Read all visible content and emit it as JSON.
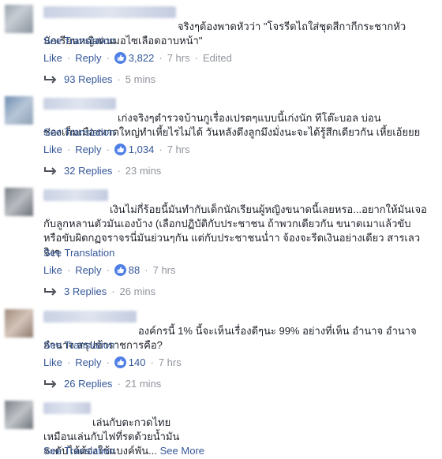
{
  "comments": [
    {
      "text": "จริงๆต้องพาดหัวว่า \"โจรรีดไถใส่ชุดสีกากีกระชากหัว\nนักเรียนหญิงคนมอไซเลือดอาบหน้า\"",
      "see_translation": "See Translation",
      "like": "Like",
      "reply": "Reply",
      "reaction_count": "3,822",
      "time": "7 hrs",
      "edited": "Edited",
      "replies_label": "93 Replies",
      "replies_time": "5 mins"
    },
    {
      "text": "เก่งจริงๆตำรวจบ้านกูเรื่องเปรตๆแบบนี้เก่งนัก ทีโต๊ะบอล บ่อน\nซ่องเต็มเมืองหาดใหญ่ทำเหี้ยไรไม่ได้ วันหลังดึงลูกมึงมั่งนะจะได้รู้สึกเดียวกัน เหี้ยเอ้ยยย",
      "see_translation": "See Translation",
      "like": "Like",
      "reply": "Reply",
      "reaction_count": "1,034",
      "time": "7 hrs",
      "replies_label": "32 Replies",
      "replies_time": "23 mins"
    },
    {
      "text": "เงินไม่กี่ร้อยนี้มันทำกับเด็กนักเรียนผู้หญิงขนาดนี้เลยหรอ...อยากให้มันเจอ\nกับลูกหลานตัวมันเองบ้าง (เลือกปฏิบัติกับประชาชน ถ้าพวกเดียวกัน ขนาดเมาแล้วขับ\nหรือขับผิดกฏจราจรนี่มันย่วนๆกัน แต่กับประชาชนน่ำา จ้องจะรีดเงินอย่างเดียว สารเลว\nจิงๆ",
      "see_translation": "See Translation",
      "like": "Like",
      "reply": "Reply",
      "reaction_count": "88",
      "time": "7 hrs",
      "replies_label": "3 Replies",
      "replies_time": "26 mins"
    },
    {
      "text": "องค์กรนี้ 1% นี้จะเห็นเรื่องดีๆนะ 99% อย่างที่เห็น อำนาจ อำนาจ\nอำนาจ สรุปข้าราชการคือ?",
      "see_translation": "See Translation",
      "like": "Like",
      "reply": "Reply",
      "reaction_count": "140",
      "time": "7 hrs",
      "replies_label": "26 Replies",
      "replies_time": "21 mins"
    },
    {
      "text": "เล่นกับตะกวดไทย\nเหมือนเล่นกับไฟที่รดด้วยน้ำมัน\nจะดับได้ต้องใช้แบงค์พัน...",
      "see_more": "See More",
      "see_translation": "See Translation"
    }
  ],
  "colors": {
    "link": "#365899",
    "meta": "#90949c",
    "text": "#1d2129",
    "like_bubble": "#4f7fe6"
  },
  "icons": {
    "like": "thumbs-up-icon",
    "reply_arrow": "reply-arrow-icon"
  }
}
